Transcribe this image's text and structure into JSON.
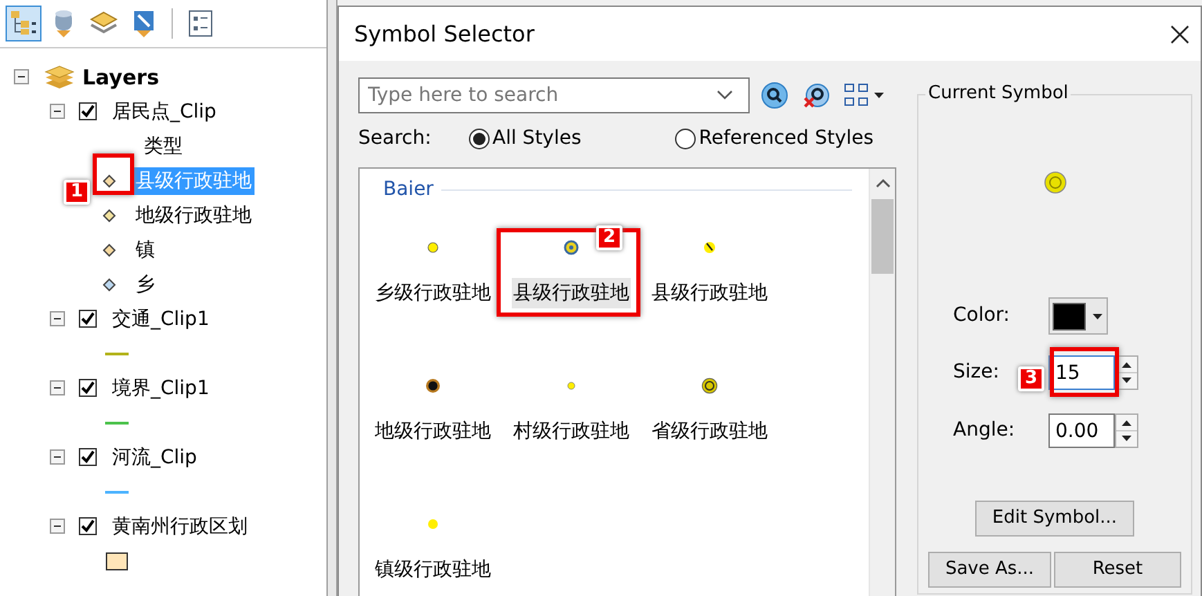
{
  "toc_toolbar": [
    {
      "kind": "drawing-order",
      "selected": true
    },
    {
      "kind": "source",
      "selected": false
    },
    {
      "kind": "visibility",
      "selected": false
    },
    {
      "kind": "selection",
      "selected": false
    },
    {
      "kind": "options",
      "selected": false
    }
  ],
  "layers": {
    "label": "Layers",
    "expanded": true,
    "children": [
      {
        "label": "居民点_Clip",
        "checked": true,
        "expanded": true,
        "legend_heading": "类型",
        "legend": [
          {
            "kind": "point",
            "label": "县级行政驻地",
            "selected": true,
            "color": "#f3d9a4",
            "callout": "1"
          },
          {
            "kind": "point",
            "label": "地级行政驻地",
            "selected": false,
            "color": "#f3e3a0"
          },
          {
            "kind": "point",
            "label": "镇",
            "selected": false,
            "color": "#f5d9a0"
          },
          {
            "kind": "point",
            "label": "乡",
            "selected": false,
            "color": "#bcd8f0"
          }
        ]
      },
      {
        "label": "交通_Clip1",
        "checked": true,
        "expanded": true,
        "legend": [
          {
            "kind": "line",
            "color": "#b3b31a"
          }
        ]
      },
      {
        "label": "境界_Clip1",
        "checked": true,
        "expanded": true,
        "legend": [
          {
            "kind": "line",
            "color": "#4cc24c"
          }
        ]
      },
      {
        "label": "河流_Clip",
        "checked": true,
        "expanded": true,
        "legend": [
          {
            "kind": "line",
            "color": "#4db3ff"
          }
        ]
      },
      {
        "label": "黄南州行政区划",
        "checked": true,
        "expanded": true,
        "legend": [
          {
            "kind": "polygon",
            "color": "#ffe5b8"
          }
        ]
      }
    ]
  },
  "dialog": {
    "title": "Symbol Selector",
    "search": {
      "placeholder": "Type here to search"
    },
    "search_label": "Search:",
    "scopes": [
      {
        "label": "All Styles",
        "selected": true
      },
      {
        "label": "Referenced Styles",
        "selected": false
      }
    ],
    "symbol_groups": [
      {
        "name": "Baier",
        "symbols": [
          {
            "kind": "small",
            "label": "乡级行政驻地",
            "selected": false
          },
          {
            "kind": "badge",
            "label": "县级行政驻地",
            "selected": true,
            "callout": "2"
          },
          {
            "kind": "slashed",
            "label": "县级行政驻地",
            "selected": false
          },
          {
            "kind": "ringed-dark",
            "label": "地级行政驻地",
            "selected": false
          },
          {
            "kind": "tiny",
            "label": "村级行政驻地",
            "selected": false
          },
          {
            "kind": "circled",
            "label": "省级行政驻地",
            "selected": false
          },
          {
            "kind": "plain",
            "label": "镇级行政驻地",
            "selected": false
          }
        ]
      }
    ],
    "current_symbol": {
      "title": "Current Symbol",
      "color_label": "Color:",
      "color": "#000000",
      "size_label": "Size:",
      "size": "15",
      "size_callout": "3",
      "angle_label": "Angle:",
      "angle": "0.00"
    },
    "buttons": [
      {
        "label": "Edit Symbol..."
      },
      {
        "label": "Save As..."
      },
      {
        "label": "Reset"
      }
    ]
  }
}
